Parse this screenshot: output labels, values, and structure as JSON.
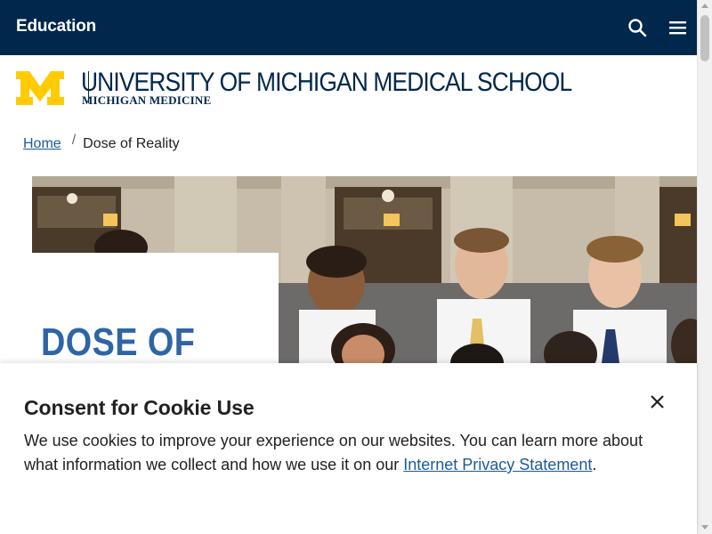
{
  "header": {
    "title": "Education",
    "search_icon": "search-icon",
    "menu_icon": "hamburger-menu-icon",
    "background": "#00274c"
  },
  "logo": {
    "wordmark": "M",
    "university": "UNIVERSITY OF MICHIGAN MEDICAL SCHOOL",
    "subtitle": "MICHIGAN MEDICINE",
    "maize": "#ffcb05",
    "blue": "#00274c"
  },
  "breadcrumb": {
    "home": "Home",
    "separator": "/",
    "current": "Dose of Reality"
  },
  "hero": {
    "heading": "DOSE OF"
  },
  "cookie_banner": {
    "title": "Consent for Cookie Use",
    "text_before_link": "We use cookies to improve your experience on our websites. You can learn more about what information we collect and how we use it on our ",
    "link_text": "Internet Privacy Statement",
    "text_after_link": ".",
    "close_icon": "close-icon"
  }
}
